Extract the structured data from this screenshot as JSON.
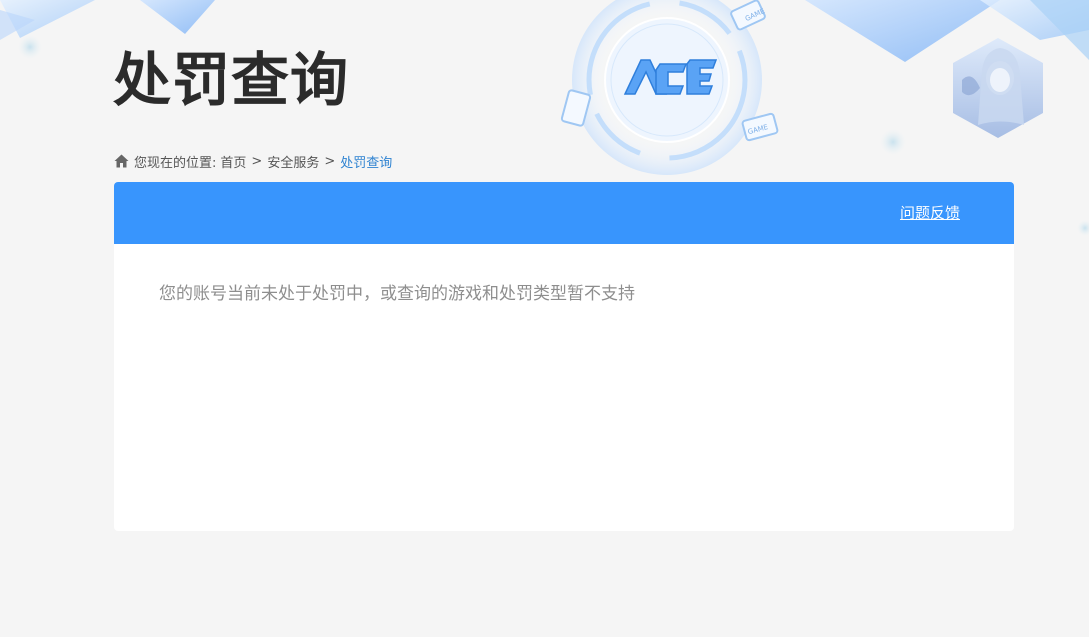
{
  "page": {
    "title": "处罚查询"
  },
  "breadcrumb": {
    "prefix": "您现在的位置:",
    "items": [
      "首页",
      "安全服务",
      "处罚查询"
    ],
    "separator": ">"
  },
  "panel": {
    "feedback_label": "问题反馈",
    "message": "您的账号当前未处于处罚中，或查询的游戏和处罚类型暂不支持"
  },
  "logo": {
    "text": "ACE",
    "badge_text": "GAME"
  },
  "colors": {
    "accent": "#3895fd",
    "link_current": "#2f83d1",
    "title": "#2b2b2b",
    "message": "#8e8e8e",
    "background": "#f5f5f5"
  },
  "icons": {
    "breadcrumb": "home-icon",
    "decor_logo": "ace-logo-icon",
    "decor_avatar": "character-avatar-icon"
  }
}
